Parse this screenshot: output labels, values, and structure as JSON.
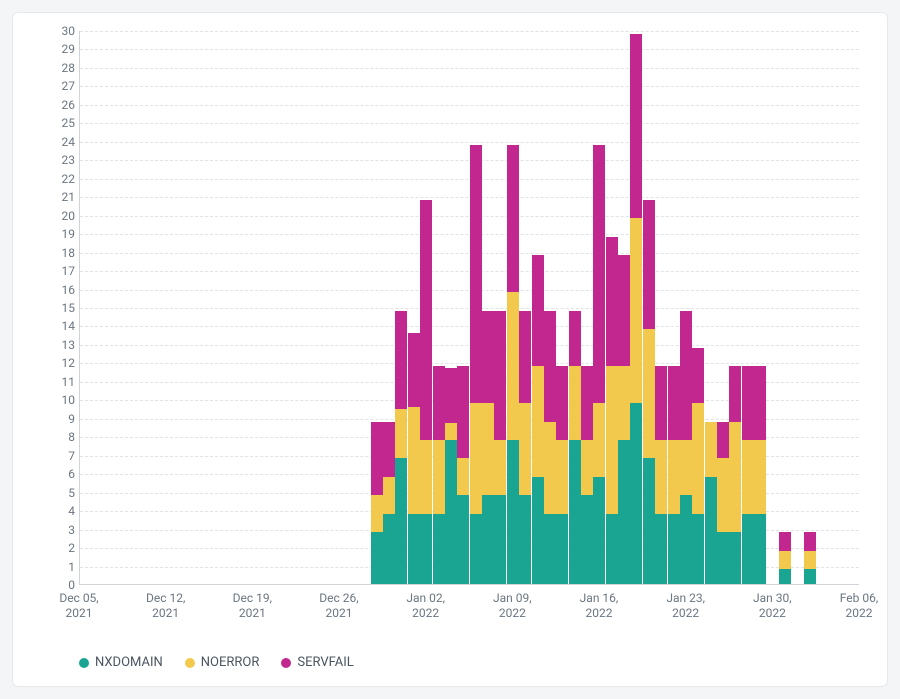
{
  "chart_data": {
    "type": "bar",
    "stacked": true,
    "title": "",
    "xlabel": "",
    "ylabel": "",
    "ylim": [
      0,
      30
    ],
    "y_ticks": [
      0,
      1,
      2,
      3,
      4,
      5,
      6,
      7,
      8,
      9,
      10,
      11,
      12,
      13,
      14,
      15,
      16,
      17,
      18,
      19,
      20,
      21,
      22,
      23,
      24,
      25,
      26,
      27,
      28,
      29,
      30
    ],
    "x_tick_labels": [
      {
        "label_top": "Dec 05,",
        "label_bottom": "2021",
        "pos": -24
      },
      {
        "label_top": "Dec 12,",
        "label_bottom": "2021",
        "pos": -17
      },
      {
        "label_top": "Dec 19,",
        "label_bottom": "2021",
        "pos": -10
      },
      {
        "label_top": "Dec 26,",
        "label_bottom": "2021",
        "pos": -3
      },
      {
        "label_top": "Jan 02,",
        "label_bottom": "2022",
        "pos": 4
      },
      {
        "label_top": "Jan 09,",
        "label_bottom": "2022",
        "pos": 11
      },
      {
        "label_top": "Jan 16,",
        "label_bottom": "2022",
        "pos": 18
      },
      {
        "label_top": "Jan 23,",
        "label_bottom": "2022",
        "pos": 25
      },
      {
        "label_top": "Jan 30,",
        "label_bottom": "2022",
        "pos": 32
      },
      {
        "label_top": "Feb 06,",
        "label_bottom": "2022",
        "pos": 39
      }
    ],
    "x_domain": [
      -24,
      39
    ],
    "categories_index": [
      0,
      1,
      2,
      3,
      4,
      5,
      6,
      7,
      8,
      9,
      10,
      11,
      12,
      13,
      14,
      15,
      16,
      17,
      18,
      19,
      20,
      21,
      22,
      23,
      24,
      25,
      26,
      27,
      28,
      29,
      30,
      31,
      32,
      33,
      34,
      35
    ],
    "series": [
      {
        "name": "NXDOMAIN",
        "color": "#1aa592",
        "values": [
          2.8,
          3.8,
          6.8,
          3.8,
          3.8,
          3.8,
          7.8,
          4.8,
          3.8,
          4.8,
          4.8,
          7.8,
          4.8,
          5.8,
          3.8,
          3.8,
          7.8,
          4.8,
          5.8,
          3.8,
          7.8,
          9.8,
          6.8,
          3.8,
          3.8,
          4.8,
          3.8,
          5.8,
          2.8,
          2.8,
          3.8,
          3.8,
          0,
          0.8,
          0,
          0.8
        ]
      },
      {
        "name": "NOERROR",
        "color": "#f2c94c",
        "values": [
          2.0,
          2.0,
          2.7,
          5.8,
          4.0,
          4.0,
          0.9,
          2.0,
          6.0,
          5.0,
          3.0,
          8.0,
          5.0,
          6.0,
          5.0,
          4.0,
          4.0,
          3.0,
          4.0,
          8.0,
          4.0,
          10.0,
          7.0,
          4.0,
          4.0,
          3.0,
          6.0,
          3.0,
          4.0,
          6.0,
          4.0,
          4.0,
          0,
          1.0,
          0,
          1.0
        ]
      },
      {
        "name": "SERVFAIL",
        "color": "#c2278f",
        "values": [
          4.0,
          3.0,
          5.3,
          4.0,
          13.0,
          4.0,
          3.0,
          5.0,
          14.0,
          5.0,
          7.0,
          8.0,
          5.0,
          6.0,
          6.0,
          4.0,
          3.0,
          4.0,
          14.0,
          7.0,
          6.0,
          10.0,
          7.0,
          4.0,
          4.0,
          7.0,
          3.0,
          0.0,
          2.0,
          3.0,
          4.0,
          4.0,
          0,
          1.0,
          0,
          1.0
        ]
      }
    ],
    "legend": [
      "NXDOMAIN",
      "NOERROR",
      "SERVFAIL"
    ]
  }
}
